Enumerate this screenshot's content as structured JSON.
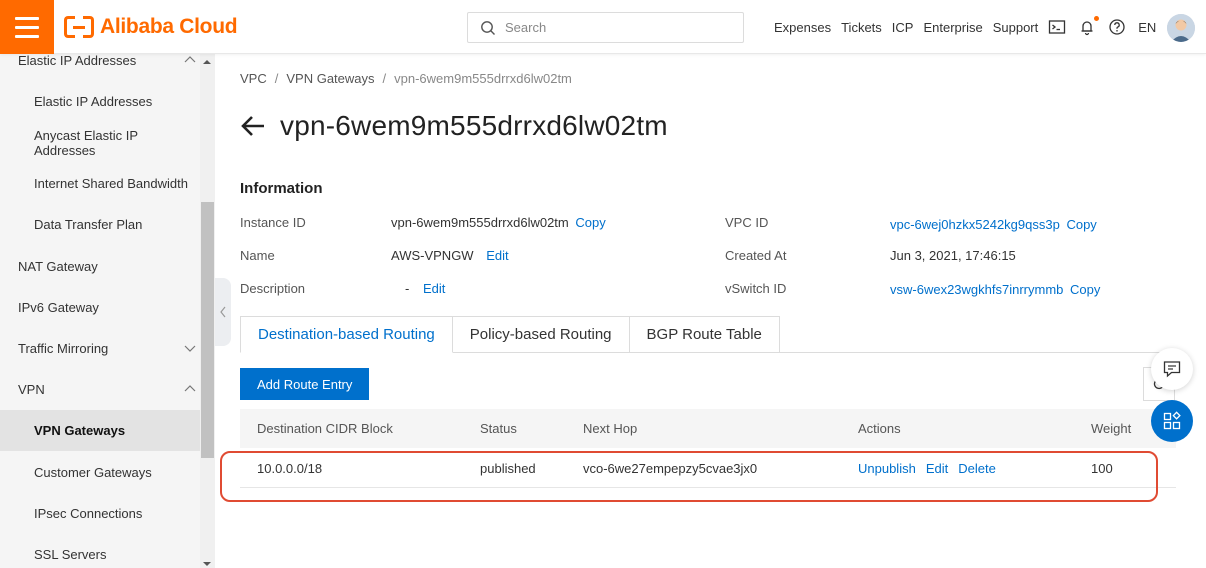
{
  "brand": {
    "name": "Alibaba Cloud",
    "accent_color": "#ff6a00",
    "link_color": "#0070cc"
  },
  "header": {
    "search_placeholder": "Search",
    "nav": [
      "Expenses",
      "Tickets",
      "ICP",
      "Enterprise",
      "Support"
    ],
    "language": "EN",
    "icons": [
      "terminal-icon",
      "bell-icon",
      "help-icon"
    ]
  },
  "sidebar": {
    "items": [
      {
        "label": "Elastic IP Addresses",
        "level": "top",
        "expanded": true
      },
      {
        "label": "Elastic IP Addresses",
        "level": "sub"
      },
      {
        "label": "Anycast Elastic IP Addresses",
        "level": "sub"
      },
      {
        "label": "Internet Shared Bandwidth",
        "level": "sub"
      },
      {
        "label": "Data Transfer Plan",
        "level": "sub"
      },
      {
        "label": "NAT Gateway",
        "level": "top"
      },
      {
        "label": "IPv6 Gateway",
        "level": "top"
      },
      {
        "label": "Traffic Mirroring",
        "level": "top",
        "expanded": false
      },
      {
        "label": "VPN",
        "level": "top",
        "expanded": true
      },
      {
        "label": "VPN Gateways",
        "level": "sub",
        "active": true
      },
      {
        "label": "Customer Gateways",
        "level": "sub"
      },
      {
        "label": "IPsec Connections",
        "level": "sub"
      },
      {
        "label": "SSL Servers",
        "level": "sub"
      }
    ]
  },
  "breadcrumb": [
    "VPC",
    "VPN Gateways",
    "vpn-6wem9m555drrxd6lw02tm"
  ],
  "page_title": "vpn-6wem9m555drrxd6lw02tm",
  "information": {
    "title": "Information",
    "instance_id_label": "Instance ID",
    "instance_id_value": "vpn-6wem9m555drrxd6lw02tm",
    "name_label": "Name",
    "name_value": "AWS-VPNGW",
    "description_label": "Description",
    "description_value": "-",
    "vpc_id_label": "VPC ID",
    "vpc_id_value": "vpc-6wej0hzkx5242kg9qss3p",
    "created_at_label": "Created At",
    "created_at_value": "Jun 3, 2021, 17:46:15",
    "vswitch_id_label": "vSwitch ID",
    "vswitch_id_value": "vsw-6wex23wgkhfs7inrrymmb",
    "copy_label": "Copy",
    "edit_label": "Edit"
  },
  "tabs": [
    {
      "label": "Destination-based Routing",
      "active": true
    },
    {
      "label": "Policy-based Routing",
      "active": false
    },
    {
      "label": "BGP Route Table",
      "active": false
    }
  ],
  "add_route_button": "Add Route Entry",
  "table": {
    "columns": [
      "Destination CIDR Block",
      "Status",
      "Next Hop",
      "Actions",
      "Weight"
    ],
    "rows": [
      {
        "destination": "10.0.0.0/18",
        "status": "published",
        "next_hop": "vco-6we27empepzy5cvae3jx0",
        "actions": [
          "Unpublish",
          "Edit",
          "Delete"
        ],
        "weight": "100"
      }
    ]
  },
  "highlight_color": "#e04b33"
}
